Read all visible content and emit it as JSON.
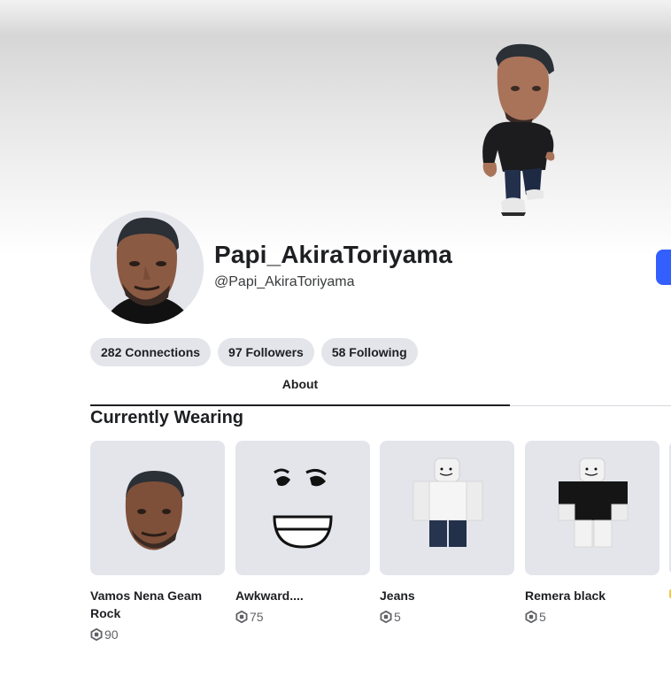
{
  "profile": {
    "display_name": "Papi_AkiraToriyama",
    "username": "@Papi_AkiraToriyama"
  },
  "stats": {
    "connections": "282 Connections",
    "followers": "97 Followers",
    "following": "58 Following"
  },
  "tabs": {
    "about": "About"
  },
  "section": {
    "title": "Currently Wearing"
  },
  "items": [
    {
      "name": "Vamos Nena Geam Rock",
      "price": "90"
    },
    {
      "name": "Awkward....",
      "price": "75"
    },
    {
      "name": "Jeans",
      "price": "5"
    },
    {
      "name": "Remera black",
      "price": "5"
    }
  ],
  "colors": {
    "accent_blue": "#335fff",
    "pill_bg": "#e3e5eb",
    "text_primary": "#1e1f22"
  },
  "icons": {
    "currency": "robux-icon"
  }
}
